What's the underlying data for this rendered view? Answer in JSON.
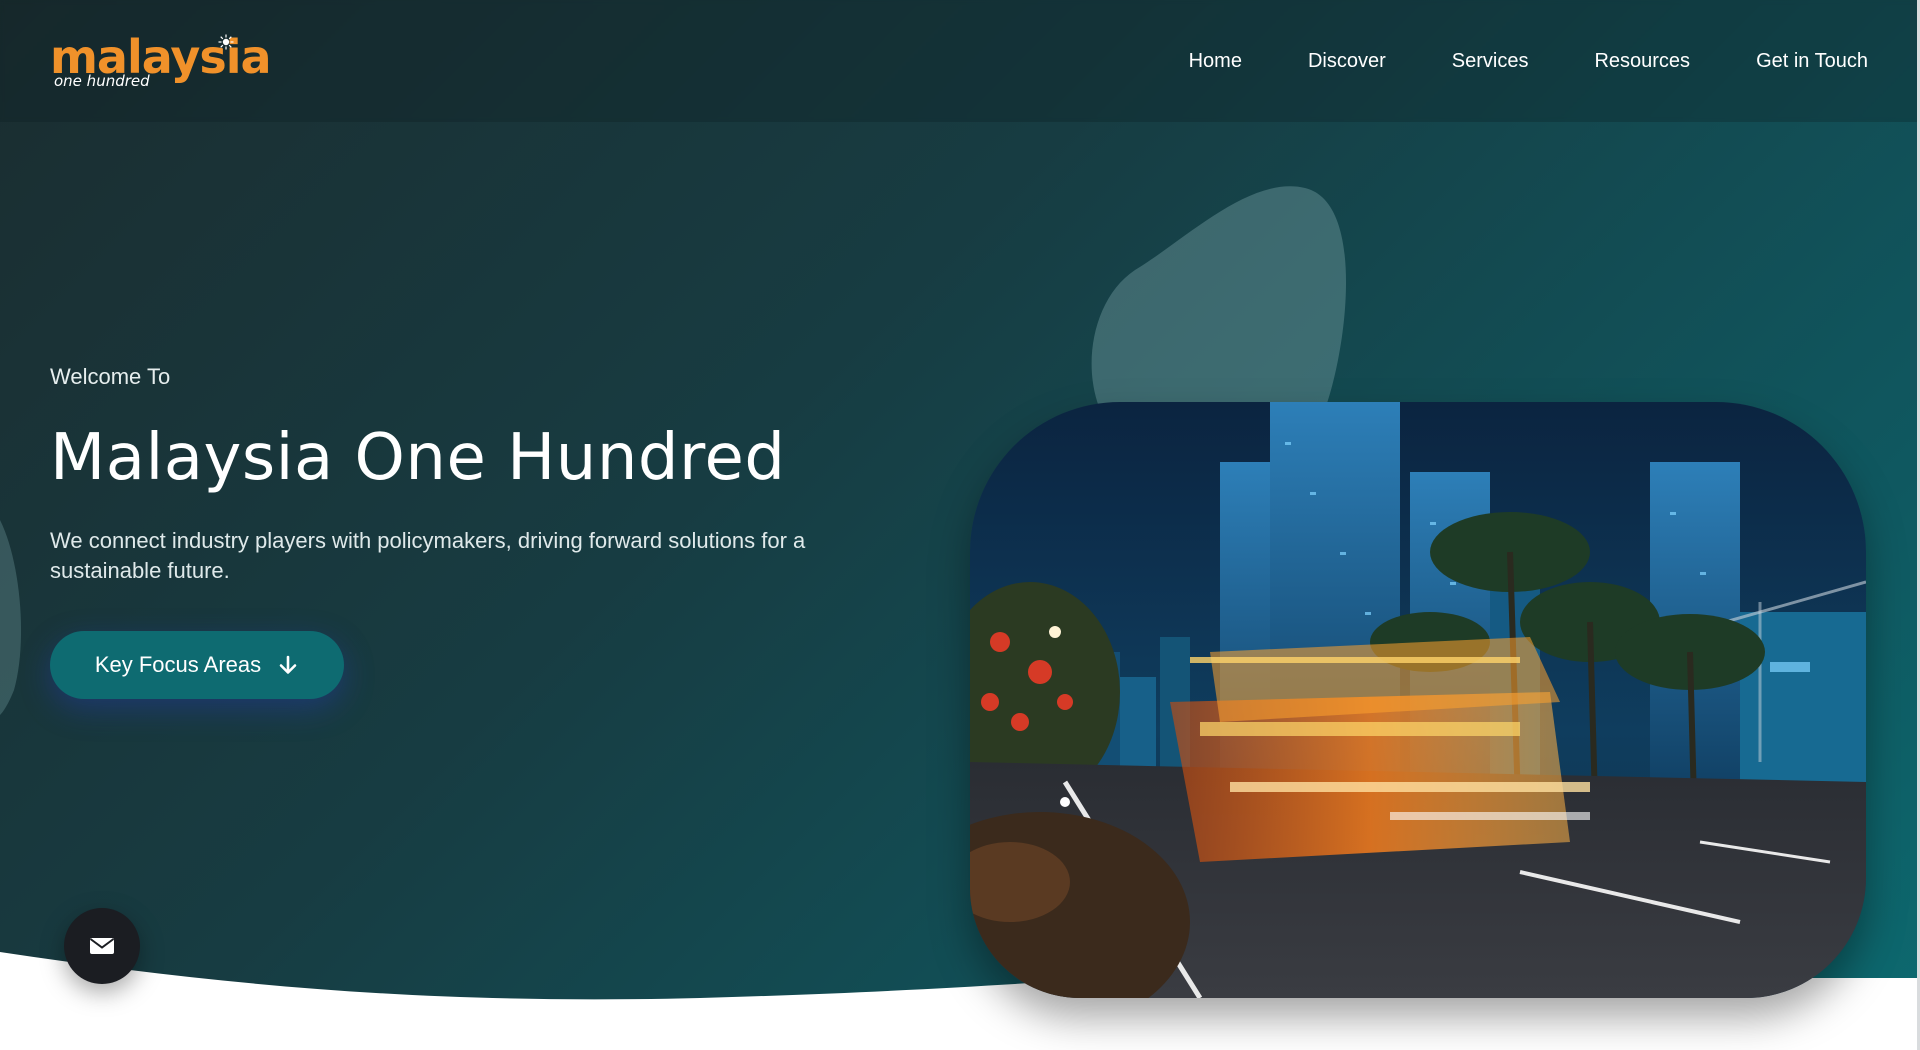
{
  "brand": {
    "logo_main": "malaysia",
    "logo_sub": "one hundred",
    "accent_color": "#f0912a"
  },
  "nav": {
    "items": [
      {
        "label": "Home"
      },
      {
        "label": "Discover"
      },
      {
        "label": "Services"
      },
      {
        "label": "Resources"
      },
      {
        "label": "Get in Touch"
      }
    ]
  },
  "hero": {
    "eyebrow": "Welcome To",
    "title": "Malaysia One Hundred",
    "description": "We connect industry players with policymakers, driving forward solutions for a sustainable future.",
    "cta_label": "Key Focus Areas",
    "cta_icon": "arrow-down-icon",
    "photo": "night-city-street-bus-light-trails"
  },
  "floating": {
    "mail_icon": "envelope-icon"
  },
  "colors": {
    "hero_dark": "#1b2d30",
    "hero_teal": "#0d6a70",
    "button_teal": "#0e6b71",
    "mail_button": "#1b1d22"
  }
}
